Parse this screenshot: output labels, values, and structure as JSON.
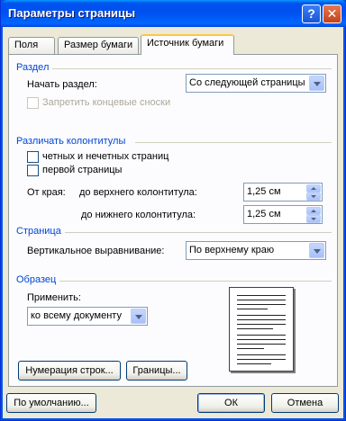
{
  "window": {
    "title": "Параметры страницы",
    "help_glyph": "?",
    "close_glyph": "✕"
  },
  "tabs": [
    {
      "label": "Поля",
      "active": false
    },
    {
      "label": "Размер бумаги",
      "active": false
    },
    {
      "label": "Источник бумаги",
      "active": true
    }
  ],
  "section_razdel": {
    "title": "Раздел",
    "start_label": "Начать раздел:",
    "start_value": "Со следующей страницы",
    "suppress_endnotes_label": "Запретить концевые сноски",
    "suppress_endnotes_checked": false
  },
  "section_headers": {
    "title": "Различать колонтитулы",
    "odd_even_label": "четных и нечетных страниц",
    "odd_even_checked": false,
    "first_page_label": "первой страницы",
    "first_page_checked": false,
    "from_edge_label": "От края:",
    "header_label": "до верхнего колонтитула:",
    "header_value": "1,25 см",
    "footer_label": "до нижнего колонтитула:",
    "footer_value": "1,25 см"
  },
  "section_page": {
    "title": "Страница",
    "valign_label": "Вертикальное выравнивание:",
    "valign_value": "По верхнему краю"
  },
  "section_preview": {
    "title": "Образец",
    "apply_label": "Применить:",
    "apply_value": "ко всему документу"
  },
  "buttons": {
    "line_numbers": "Нумерация строк...",
    "borders": "Границы...",
    "default": "По умолчанию...",
    "ok": "ОК",
    "cancel": "Отмена"
  },
  "colors": {
    "section_title": "#0046d5",
    "titlebar": "#0053ee",
    "dialog_bg": "#ece9d8"
  }
}
